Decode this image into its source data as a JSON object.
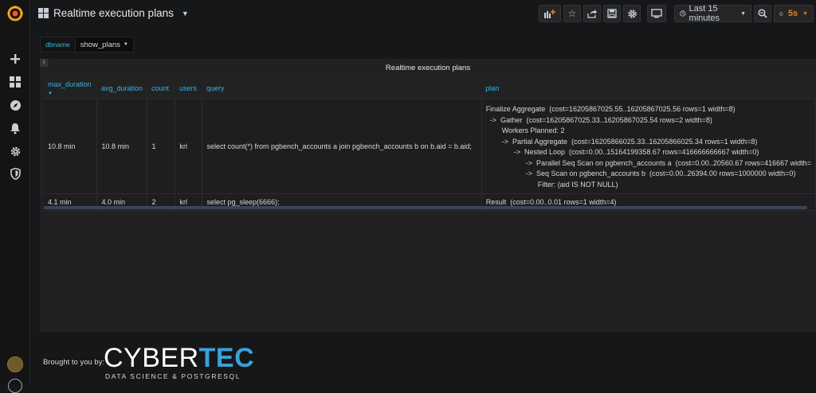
{
  "dashboard": {
    "title": "Realtime execution plans"
  },
  "toolbar": {
    "time_range": "Last 15 minutes",
    "refresh_rate": "5s"
  },
  "variables": [
    {
      "label": "dbname",
      "value": "show_plans"
    }
  ],
  "panel": {
    "title": "Realtime execution plans",
    "info": "i",
    "columns": [
      "max_duration",
      "avg_duration",
      "count",
      "users",
      "query",
      "plan"
    ],
    "rows": [
      {
        "max_duration": "10.8 min",
        "avg_duration": "10.8 min",
        "count": "1",
        "users": "krl",
        "query": "select count(*) from pgbench_accounts a join pgbench_accounts b on b.aid = b.aid;",
        "plan": "Finalize Aggregate  (cost=16205867025.55..16205867025.56 rows=1 width=8)\n  ->  Gather  (cost=16205867025.33..16205867025.54 rows=2 width=8)\n        Workers Planned: 2\n        ->  Partial Aggregate  (cost=16205866025.33..16205866025.34 rows=1 width=8)\n              ->  Nested Loop  (cost=0.00..15164199358.67 rows=416666666667 width=0)\n                    ->  Parallel Seq Scan on pgbench_accounts a  (cost=0.00..20560.67 rows=416667 width=\n                    ->  Seq Scan on pgbench_accounts b  (cost=0.00..26394.00 rows=1000000 width=0)\n                          Filter: (aid IS NOT NULL)"
      },
      {
        "max_duration": "4.1 min",
        "avg_duration": "4.0 min",
        "count": "2",
        "users": "krl",
        "query": "select pg_sleep(6666);",
        "plan": "Result  (cost=0.00..0.01 rows=1 width=4)"
      }
    ]
  },
  "footer": {
    "brought_by": "Brought to you by:",
    "brand_part1": "CYBER",
    "brand_part2": "TEC",
    "tagline": "DATA SCIENCE & POSTGRESQL"
  },
  "colors": {
    "accent": "#33b5e5",
    "brand_blue": "#3aa1d9",
    "refresh": "#eb7b18",
    "background": "#161719",
    "panel": "#212124"
  },
  "icons": [
    "grafana-logo-icon",
    "plus-icon",
    "dashboards-icon",
    "explore-icon",
    "bell-icon",
    "gear-icon",
    "shield-icon",
    "add-panel-icon",
    "star-icon",
    "share-icon",
    "save-icon",
    "settings-icon",
    "tv-icon",
    "clock-icon",
    "zoom-out-icon",
    "refresh-icon"
  ]
}
